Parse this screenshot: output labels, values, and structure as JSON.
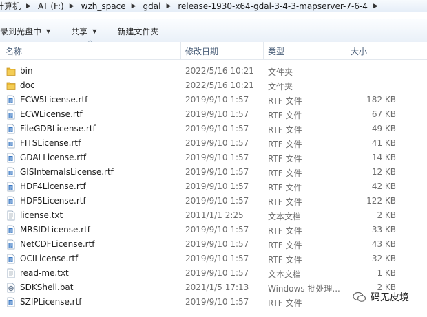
{
  "address": {
    "crumbs": [
      "计算机",
      "AT (F:)",
      "wzh_space",
      "gdal",
      "release-1930-x64-gdal-3-4-3-mapserver-7-6-4"
    ]
  },
  "toolbar": {
    "organize": "刻录到光盘中",
    "share": "共享",
    "new_folder": "新建文件夹"
  },
  "columns": {
    "name": "名称",
    "date": "修改日期",
    "type": "类型",
    "size": "大小"
  },
  "files": [
    {
      "name": "bin",
      "date": "2022/5/16 10:21",
      "type": "文件夹",
      "size": "",
      "icon": "folder-icon"
    },
    {
      "name": "doc",
      "date": "2022/5/16 10:21",
      "type": "文件夹",
      "size": "",
      "icon": "folder-icon"
    },
    {
      "name": "ECW5License.rtf",
      "date": "2019/9/10 1:57",
      "type": "RTF 文件",
      "size": "182 KB",
      "icon": "rtf-file-icon"
    },
    {
      "name": "ECWLicense.rtf",
      "date": "2019/9/10 1:57",
      "type": "RTF 文件",
      "size": "67 KB",
      "icon": "rtf-file-icon"
    },
    {
      "name": "FileGDBLicense.rtf",
      "date": "2019/9/10 1:57",
      "type": "RTF 文件",
      "size": "49 KB",
      "icon": "rtf-file-icon"
    },
    {
      "name": "FITSLicense.rtf",
      "date": "2019/9/10 1:57",
      "type": "RTF 文件",
      "size": "41 KB",
      "icon": "rtf-file-icon"
    },
    {
      "name": "GDALLicense.rtf",
      "date": "2019/9/10 1:57",
      "type": "RTF 文件",
      "size": "14 KB",
      "icon": "rtf-file-icon"
    },
    {
      "name": "GISInternalsLicense.rtf",
      "date": "2019/9/10 1:57",
      "type": "RTF 文件",
      "size": "12 KB",
      "icon": "rtf-file-icon"
    },
    {
      "name": "HDF4License.rtf",
      "date": "2019/9/10 1:57",
      "type": "RTF 文件",
      "size": "42 KB",
      "icon": "rtf-file-icon"
    },
    {
      "name": "HDF5License.rtf",
      "date": "2019/9/10 1:57",
      "type": "RTF 文件",
      "size": "122 KB",
      "icon": "rtf-file-icon"
    },
    {
      "name": "license.txt",
      "date": "2011/1/1 2:25",
      "type": "文本文档",
      "size": "2 KB",
      "icon": "text-file-icon"
    },
    {
      "name": "MRSIDLicense.rtf",
      "date": "2019/9/10 1:57",
      "type": "RTF 文件",
      "size": "33 KB",
      "icon": "rtf-file-icon"
    },
    {
      "name": "NetCDFLicense.rtf",
      "date": "2019/9/10 1:57",
      "type": "RTF 文件",
      "size": "43 KB",
      "icon": "rtf-file-icon"
    },
    {
      "name": "OCILicense.rtf",
      "date": "2019/9/10 1:57",
      "type": "RTF 文件",
      "size": "32 KB",
      "icon": "rtf-file-icon"
    },
    {
      "name": "read-me.txt",
      "date": "2019/9/10 1:57",
      "type": "文本文档",
      "size": "1 KB",
      "icon": "text-file-icon"
    },
    {
      "name": "SDKShell.bat",
      "date": "2021/1/5 17:13",
      "type": "Windows 批处理...",
      "size": "2 KB",
      "icon": "batch-file-icon"
    },
    {
      "name": "SZIPLicense.rtf",
      "date": "2019/9/10 1:57",
      "type": "RTF 文件",
      "size": "",
      "icon": "rtf-file-icon"
    }
  ],
  "watermark": {
    "text": "码无皮境"
  },
  "colors": {
    "folder": "#e8b833",
    "rtf": "#3a78c4",
    "header_text": "#4c607a"
  }
}
